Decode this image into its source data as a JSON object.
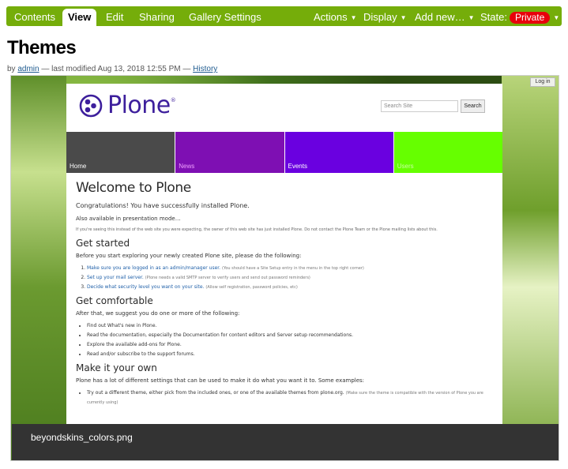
{
  "toolbar": {
    "tabs": [
      {
        "label": "Contents"
      },
      {
        "label": "View"
      },
      {
        "label": "Edit"
      },
      {
        "label": "Sharing"
      },
      {
        "label": "Gallery Settings"
      }
    ],
    "actions_label": "Actions",
    "display_label": "Display",
    "add_new_label": "Add new…",
    "state_label": "State:",
    "state_value": "Private",
    "caret": "▼",
    "colors": {
      "bar": "#75ad0a",
      "state": "#e8000b"
    }
  },
  "page": {
    "title": "Themes",
    "by_label": "by",
    "author": "admin",
    "modified_text": "— last modified Aug 13, 2018 12:55 PM —",
    "history_link": "History"
  },
  "preview": {
    "login": "Log in",
    "logo_text": "Plone",
    "logo_mark": "®",
    "search_placeholder": "Search Site",
    "search_button": "Search",
    "nav": [
      {
        "label": "Home",
        "color": "#4a4a4a"
      },
      {
        "label": "News",
        "color": "#7e0fb3"
      },
      {
        "label": "Events",
        "color": "#6a00e0"
      },
      {
        "label": "Users",
        "color": "#66ff00"
      }
    ],
    "content": {
      "h1": "Welcome to Plone",
      "lead": "Congratulations! You have successfully installed Plone.",
      "presentation": "Also available in presentation mode…",
      "notice": "If you're seeing this instead of the web site you were expecting, the owner of this web site has just installed Plone. Do not contact the Plone Team or the Plone mailing lists about this.",
      "get_started": "Get started",
      "before": "Before you start exploring your newly created Plone site, please do the following:",
      "steps": [
        {
          "text": "Make sure you are logged in as an admin/manager user.",
          "note": "(You should have a Site Setup entry in the menu in the top right corner)"
        },
        {
          "text": "Set up your mail server.",
          "note": "(Plone needs a valid SMTP server to verify users and send out password reminders)"
        },
        {
          "text": "Decide what security level you want on your site.",
          "note": "(Allow self registration, password policies, etc)"
        }
      ],
      "get_comfortable": "Get comfortable",
      "after": "After that, we suggest you do one or more of the following:",
      "suggestions": [
        {
          "text": "Find out What's new in Plone."
        },
        {
          "text": "Read the documentation, especially the Documentation for content editors and Server setup recommendations."
        },
        {
          "text": "Explore the available add-ons for Plone."
        },
        {
          "text": "Read and/or subscribe to the support forums."
        }
      ],
      "make_own": "Make it your own",
      "settings": "Plone has a lot of different settings that can be used to make it do what you want it to. Some examples:",
      "examples": [
        {
          "text": "Try out a different theme, either pick from the included ones, or one of the available themes from plone.org.",
          "note": "(Make sure the theme is compatible with the version of Plone you are currently using)"
        }
      ]
    },
    "caption": "beyondskins_colors.png"
  }
}
